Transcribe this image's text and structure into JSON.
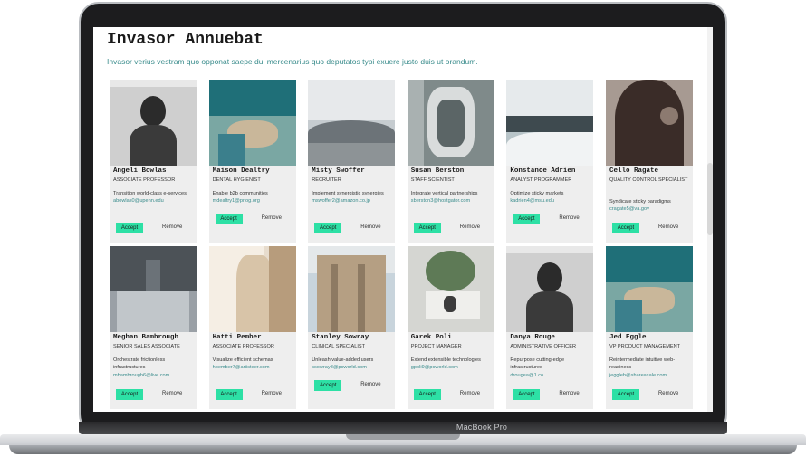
{
  "device": {
    "brand": "MacBook Pro"
  },
  "page": {
    "title": "Invasor Annuebat",
    "subtitle": "Invasor verius vestram quo opponat saepe dui mercenarius quo deputatos typi exuere justo duis ut orandum."
  },
  "actions": {
    "accept_label": "Accept",
    "remove_label": "Remove"
  },
  "cards": [
    {
      "name": "Angeli Bowlas",
      "role": "Associate Professor",
      "desc": "Transition world-class e-services",
      "email": "abowlas0@upenn.edu"
    },
    {
      "name": "Maison Dealtry",
      "role": "Dental Hygienist",
      "desc": "Enable b2b communities",
      "email": "mdealtry1@prlog.org"
    },
    {
      "name": "Misty Swoffer",
      "role": "Recruiter",
      "desc": "Implement synergistic synergies",
      "email": "mswoffer2@amazon.co.jp"
    },
    {
      "name": "Susan Berston",
      "role": "Staff Scientist",
      "desc": "Integrate vertical partnerships",
      "email": "sberston3@hostgator.com"
    },
    {
      "name": "Konstance Adrien",
      "role": "Analyst Programmer",
      "desc": "Optimize sticky markets",
      "email": "kadrien4@msu.edu"
    },
    {
      "name": "Cello Ragate",
      "role": "Quality Control Specialist",
      "desc": "Syndicate sticky paradigms",
      "email": "cragate5@va.gov"
    },
    {
      "name": "Meghan Bambrough",
      "role": "Senior Sales Associate",
      "desc": "Orchestrate frictionless infrastructures",
      "email": "mbambrough6@live.com"
    },
    {
      "name": "Hatti Pember",
      "role": "Associate Professor",
      "desc": "Visualize efficient schemas",
      "email": "hpember7@artisteer.com"
    },
    {
      "name": "Stanley Sowray",
      "role": "Clinical Specialist",
      "desc": "Unleash value-added users",
      "email": "ssowray8@pcworld.com"
    },
    {
      "name": "Garek Poli",
      "role": "Project Manager",
      "desc": "Extend extensible technologies",
      "email": "gpoli9@pcworld.com"
    },
    {
      "name": "Danya Rouge",
      "role": "Administrative Officer",
      "desc": "Repurpose cutting-edge infrastructures",
      "email": "drougea@1.co"
    },
    {
      "name": "Jed Eggle",
      "role": "VP Product Management",
      "desc": "Reintermediate intuitive web-readiness",
      "email": "jeggleb@shareasale.com"
    }
  ],
  "colors": {
    "accent": "#2de0a5",
    "link": "#3a8c8c",
    "card_bg": "#eeeeee"
  }
}
